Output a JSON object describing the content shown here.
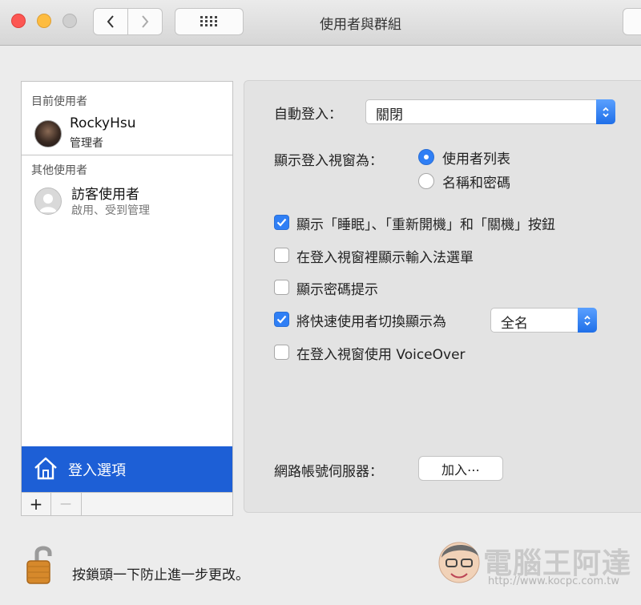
{
  "window": {
    "title": "使用者與群組"
  },
  "sidebar": {
    "current_label": "目前使用者",
    "current_user": {
      "name": "RockyHsu",
      "role": "管理者"
    },
    "other_label": "其他使用者",
    "other_user": {
      "name": "訪客使用者",
      "status": "啟用、受到管理"
    },
    "login_options": "登入選項",
    "add": "+",
    "remove": "—"
  },
  "login": {
    "auto_login_label": "自動登入：",
    "auto_login_value": "關閉",
    "display_as_label": "顯示登入視窗為：",
    "radio_users": "使用者列表",
    "radio_name_pw": "名稱和密碼",
    "cb_sleep": "顯示「睡眠」、「重新開機」和「關機」按鈕",
    "cb_input_menu": "在登入視窗裡顯示輸入法選單",
    "cb_pw_hint": "顯示密碼提示",
    "cb_fast_switch": "將快速使用者切換顯示為",
    "fast_switch_value": "全名",
    "cb_voiceover": "在登入視窗使用 VoiceOver",
    "network_label": "網路帳號伺服器：",
    "join_button": "加入⋯"
  },
  "footer": {
    "lock_text": "按鎖頭一下防止進一步更改。"
  },
  "watermark": {
    "site": "電腦王阿達",
    "url": "http://www.kocpc.com.tw"
  },
  "colors": {
    "accent": "#2f7ff5",
    "selection": "#1d5fd6"
  }
}
